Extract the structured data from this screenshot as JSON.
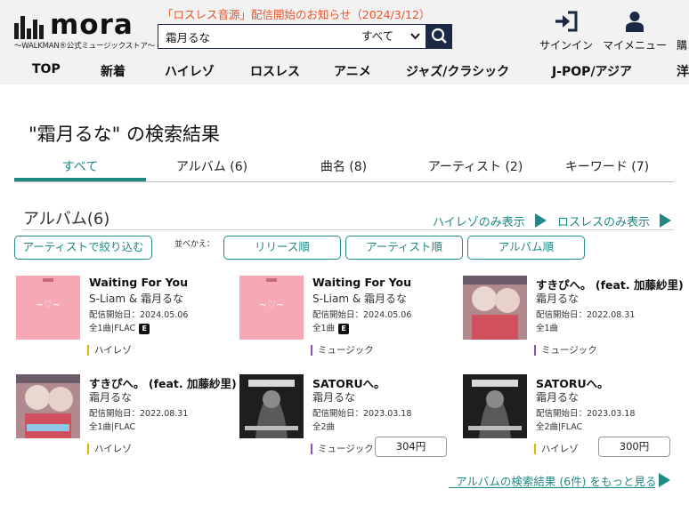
{
  "header": {
    "logo_word": "mora",
    "logo_tagline": "〜WALKMAN®公式ミュージックストア〜",
    "notice": "「ロスレス音源」配信開始のお知らせ（2024/3/12）",
    "search": {
      "value": "霜月るな",
      "category": "すべて"
    },
    "signin": "サインイン",
    "mymenu": "マイメニュー",
    "purchase": "購"
  },
  "nav": [
    "TOP",
    "新着",
    "ハイレゾ",
    "ロスレス",
    "アニメ",
    "ジャズ/クラシック",
    "J-POP/アジア",
    "洋"
  ],
  "page_title": "\"霜月るな\" の検索結果",
  "tabs": [
    "すべて",
    "アルバム (6)",
    "曲名 (8)",
    "アーティスト (2)",
    "キーワード (7)"
  ],
  "section": {
    "title": "アルバム(6)",
    "hires_only": "ハイレゾのみ表示",
    "lossless_only": "ロスレスのみ表示",
    "filter_button": "アーティストで絞り込む",
    "sort_label": "並べかえ：",
    "sort_release": "リリース順",
    "sort_artist": "アーティスト順",
    "sort_album": "アルバム順"
  },
  "albums": [
    {
      "title": "Waiting For You",
      "artist": "S-Liam & 霜月るな",
      "date": "配信開始日：2024.05.06",
      "count": "全1曲|FLAC",
      "explicit": "E",
      "tag": "ハイレゾ",
      "price": ""
    },
    {
      "title": "Waiting For You",
      "artist": "S-Liam & 霜月るな",
      "date": "配信開始日：2024.05.06",
      "count": "全1曲",
      "explicit": "E",
      "tag": "ミュージック",
      "price": ""
    },
    {
      "title": "すきぴへ。 (feat. 加藤紗里)",
      "artist": "霜月るな",
      "date": "配信開始日：2022.08.31",
      "count": "全1曲",
      "explicit": "",
      "tag": "ミュージック",
      "price": ""
    },
    {
      "title": "すきぴへ。 (feat. 加藤紗里)",
      "artist": "霜月るな",
      "date": "配信開始日：2022.08.31",
      "count": "全1曲|FLAC",
      "explicit": "",
      "tag": "ハイレゾ",
      "price": ""
    },
    {
      "title": "SATORUへ。",
      "artist": "霜月るな",
      "date": "配信開始日：2023.03.18",
      "count": "全2曲",
      "explicit": "",
      "tag": "ミュージック",
      "price": "304円"
    },
    {
      "title": "SATORUへ。",
      "artist": "霜月るな",
      "date": "配信開始日：2023.03.18",
      "count": "全2曲|FLAC",
      "explicit": "",
      "tag": "ハイレゾ",
      "price": "300円"
    }
  ],
  "more_link": "アルバムの検索結果 (6件) をもっと見る",
  "colors": {
    "accent": "#1f8a84",
    "notice": "#e8542a",
    "search_dark": "#1b2a44",
    "hires_tag": "#e8b400",
    "music_tag": "#8a4fb8"
  }
}
